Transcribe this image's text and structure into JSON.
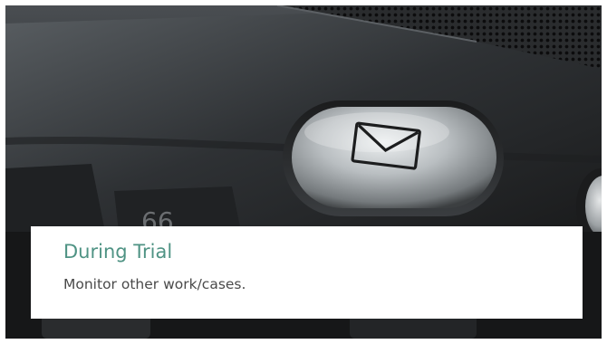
{
  "slide": {
    "title": "During Trial",
    "subtitle": "Monitor other work/cases."
  },
  "photo": {
    "subject": "mail-key-photo",
    "icon": "envelope-icon"
  },
  "colors": {
    "title": "#4f9384",
    "subtitle": "#4a4a4a",
    "caption_background": "#ffffff"
  }
}
